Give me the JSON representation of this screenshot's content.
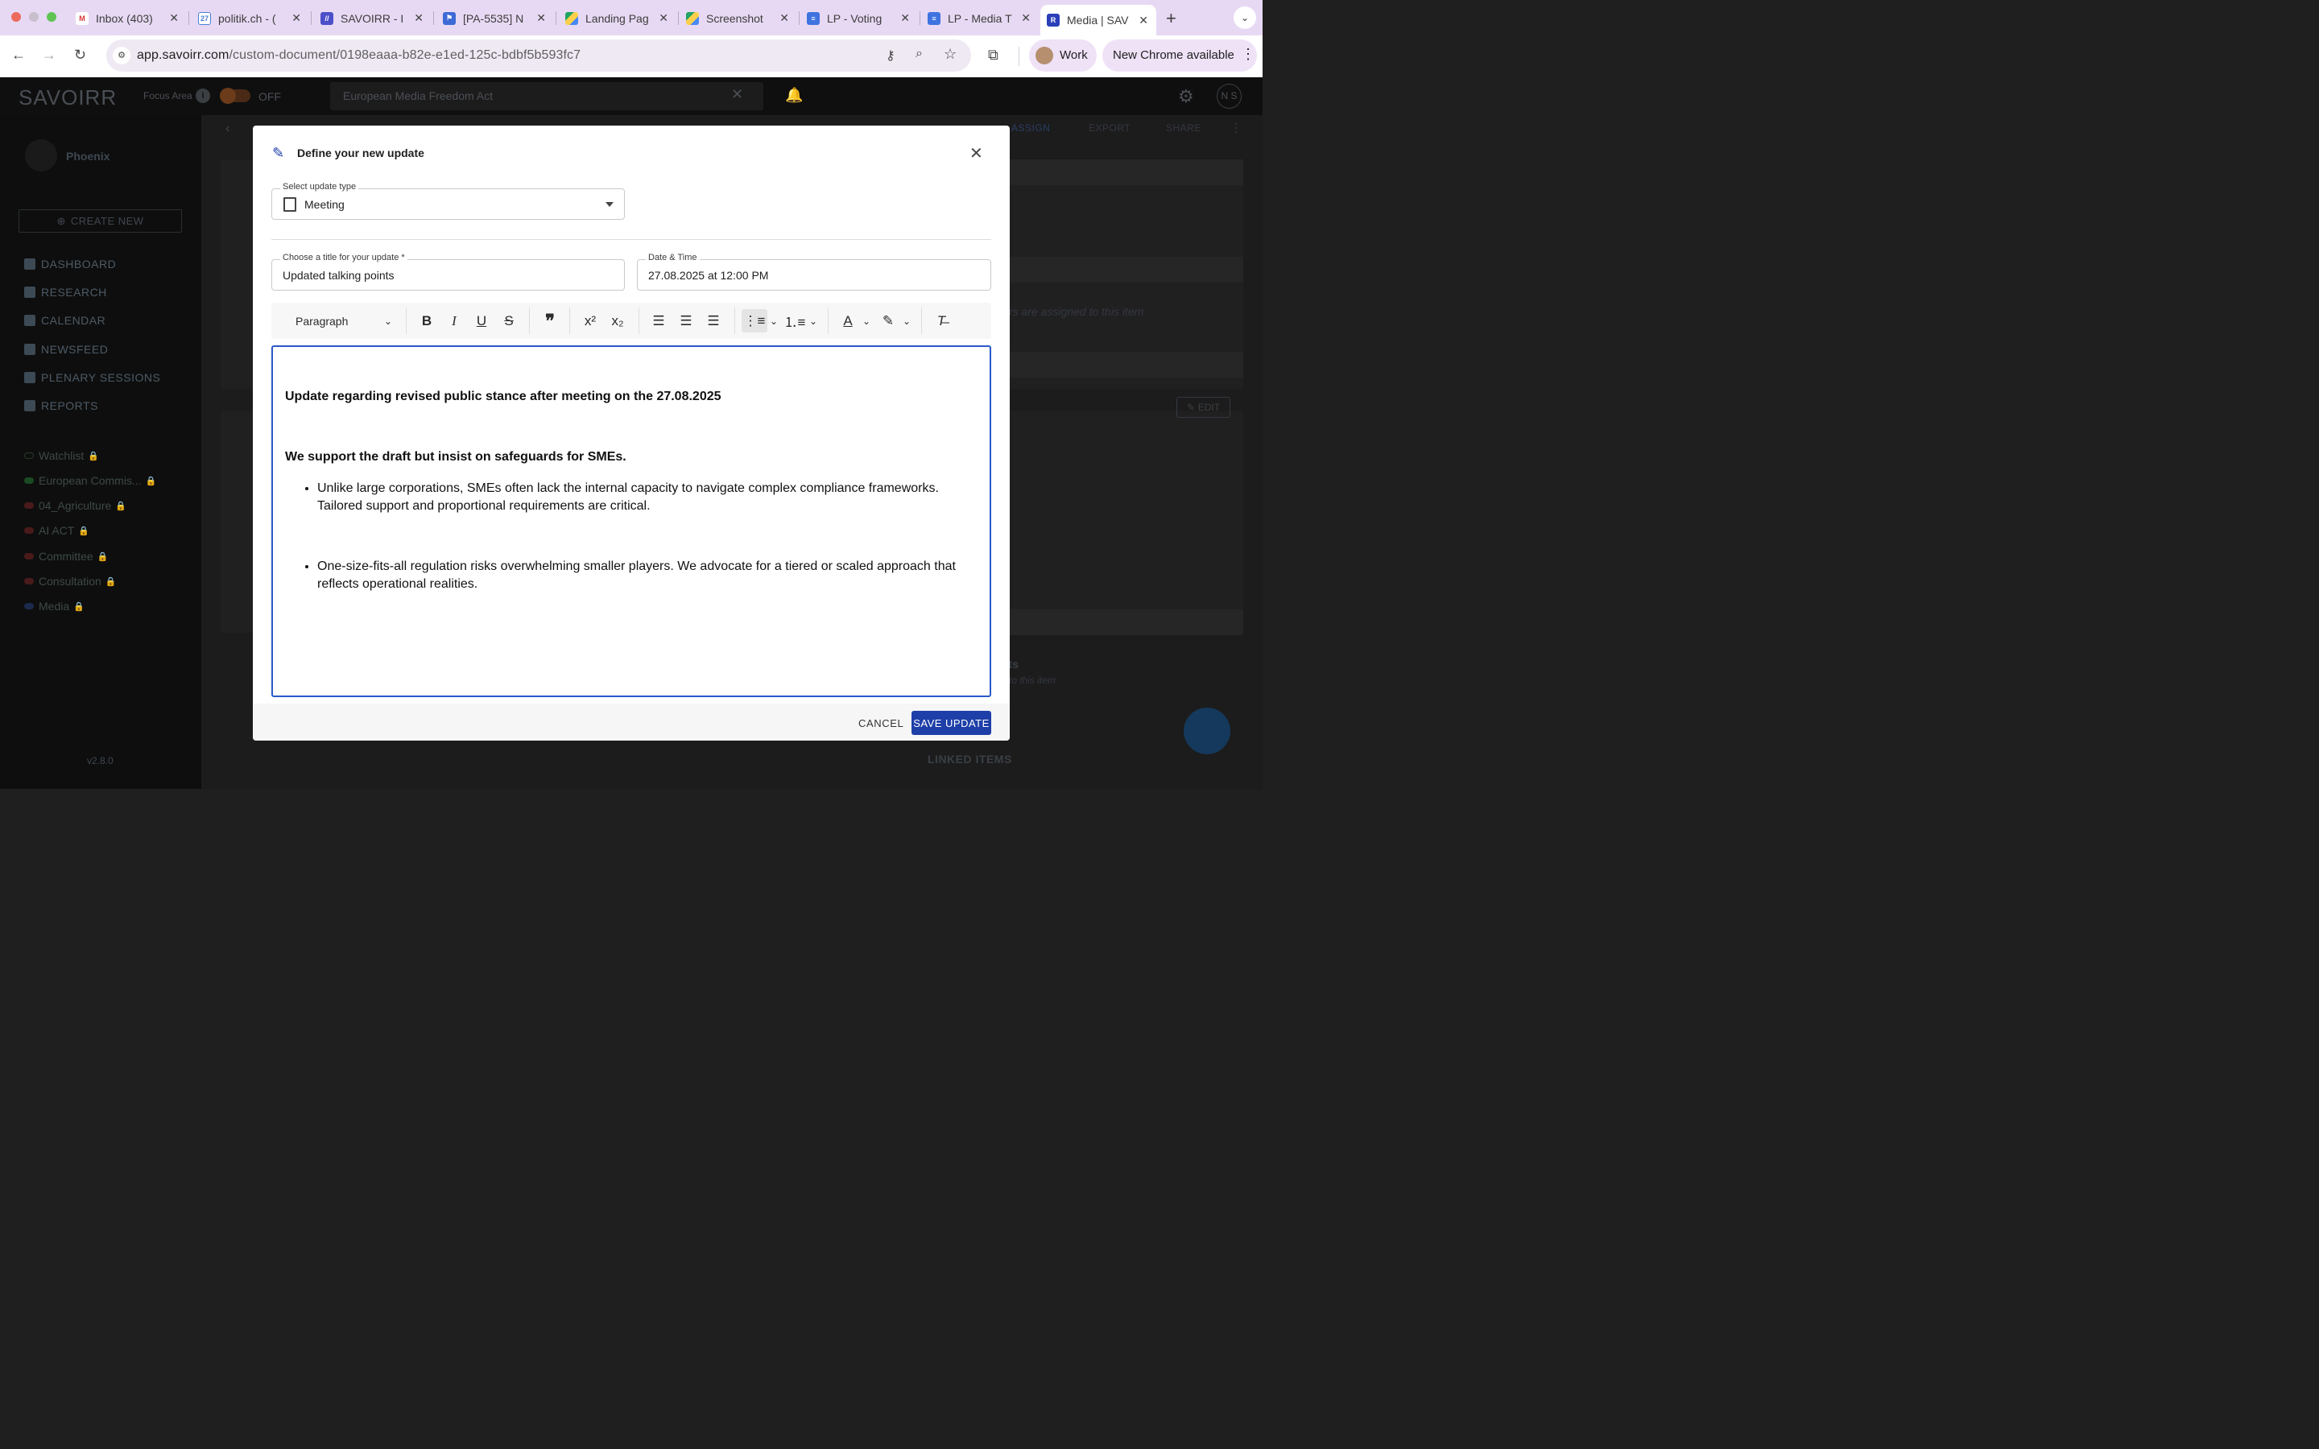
{
  "browser": {
    "tabs": [
      {
        "title": "Inbox (403)",
        "favicon": "gmail-icon"
      },
      {
        "title": "politik.ch - (",
        "favicon": "calendar-icon"
      },
      {
        "title": "SAVOIRR - I",
        "favicon": "linear-icon"
      },
      {
        "title": "[PA-5535] N",
        "favicon": "jira-icon"
      },
      {
        "title": "Landing Pag",
        "favicon": "drive-icon"
      },
      {
        "title": "Screenshot",
        "favicon": "drive-icon"
      },
      {
        "title": "LP - Voting",
        "favicon": "docs-icon"
      },
      {
        "title": "LP - Media T",
        "favicon": "docs-icon"
      },
      {
        "title": "Media | SAV",
        "favicon": "savoirr-icon"
      }
    ],
    "url_host": "app.savoirr.com",
    "url_path": "/custom-document/0198eaaa-b82e-e1ed-125c-bdbf5b593fc7",
    "profile_label": "Work",
    "update_label": "New Chrome available"
  },
  "app": {
    "logo": "SAVOIRR",
    "focus_area_label": "Focus Area",
    "focus_toggle": "OFF",
    "search_value": "European Media Freedom Act",
    "avatar_initials": "N S",
    "workspace": "Phoenix",
    "create_new": "CREATE NEW",
    "nav": [
      "DASHBOARD",
      "RESEARCH",
      "CALENDAR",
      "NEWSFEED",
      "PLENARY SESSIONS",
      "REPORTS"
    ],
    "watchlists": [
      {
        "label": "Watchlist",
        "color": "#2a3a2a"
      },
      {
        "label": "European Commis...",
        "color": "#1d6b2a"
      },
      {
        "label": "04_Agriculture",
        "color": "#8b2020"
      },
      {
        "label": "AI ACT",
        "color": "#8b2020"
      },
      {
        "label": "Committee",
        "color": "#8b2020"
      },
      {
        "label": "Consultation",
        "color": "#8b2020"
      },
      {
        "label": "Media",
        "color": "#1d3c8b"
      }
    ],
    "version": "v2.8.0",
    "bg_assign": "ASSIGN",
    "bg_export": "EXPORT",
    "bg_share": "SHARE",
    "bg_edit": "EDIT",
    "bg_linked_items": "LINKED ITEMS",
    "bg_assigned_text": "rs are assigned to this item",
    "bg_nts": "nts",
    "bg_to_this_item": "to this item"
  },
  "modal": {
    "title": "Define your new update",
    "update_type_label": "Select update type",
    "update_type_value": "Meeting",
    "title_field_label": "Choose a title for your update *",
    "title_field_value": "Updated talking points",
    "datetime_label": "Date & Time",
    "datetime_value": "27.08.2025 at 12:00 PM",
    "paragraph_style": "Paragraph",
    "content": {
      "heading1": "Update regarding revised public stance after meeting on the 27.08.2025",
      "heading2": "We support the draft but insist on safeguards for SMEs.",
      "bullet1": "Unlike large corporations, SMEs often lack the internal capacity to navigate complex compliance frameworks. Tailored support and proportional requirements are critical.",
      "bullet2": "One-size-fits-all regulation risks overwhelming smaller players. We advocate for a tiered or scaled approach that reflects operational realities."
    },
    "cancel_label": "CANCEL",
    "save_label": "SAVE UPDATE"
  }
}
